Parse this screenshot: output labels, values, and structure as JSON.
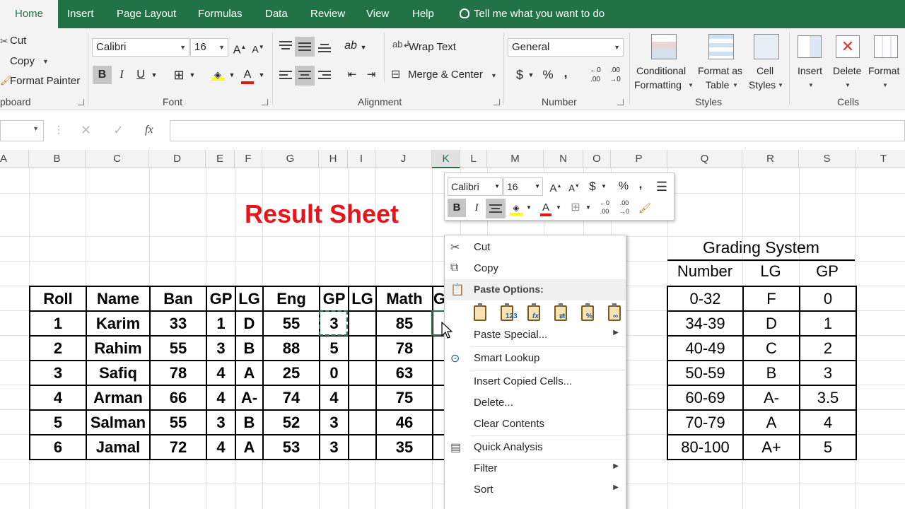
{
  "tabs": [
    "Home",
    "Insert",
    "Page Layout",
    "Formulas",
    "Data",
    "Review",
    "View",
    "Help"
  ],
  "tell_me": "Tell me what you want to do",
  "clipboard": {
    "cut": "Cut",
    "copy": "Copy",
    "format_painter": "Format Painter",
    "label": "pboard"
  },
  "font": {
    "name": "Calibri",
    "size": "16",
    "label": "Font"
  },
  "alignment": {
    "wrap": "Wrap Text",
    "merge": "Merge & Center",
    "label": "Alignment"
  },
  "number": {
    "format": "General",
    "label": "Number"
  },
  "styles": {
    "cond1": "Conditional",
    "cond2": "Formatting",
    "fat1": "Format as",
    "fat2": "Table",
    "cs1": "Cell",
    "cs2": "Styles",
    "label": "Styles"
  },
  "cells": {
    "insert": "Insert",
    "delete": "Delete",
    "format": "Format",
    "label": "Cells"
  },
  "formula_bar": {
    "fx": "fx",
    "value": ""
  },
  "columns": [
    "A",
    "B",
    "C",
    "D",
    "E",
    "F",
    "G",
    "H",
    "I",
    "J",
    "K",
    "L",
    "M",
    "N",
    "O",
    "P",
    "Q",
    "R",
    "S",
    "T"
  ],
  "sheet_title": "Result Sheet",
  "result_table": {
    "headers": [
      "Roll",
      "Name",
      "Ban",
      "GP",
      "LG",
      "Eng",
      "GP",
      "LG",
      "Math",
      "G"
    ],
    "rows": [
      [
        "1",
        "Karim",
        "33",
        "1",
        "D",
        "55",
        "3",
        "",
        "85"
      ],
      [
        "2",
        "Rahim",
        "55",
        "3",
        "B",
        "88",
        "5",
        "",
        "78"
      ],
      [
        "3",
        "Safiq",
        "78",
        "4",
        "A",
        "25",
        "0",
        "",
        "63"
      ],
      [
        "4",
        "Arman",
        "66",
        "4",
        "A-",
        "74",
        "4",
        "",
        "75"
      ],
      [
        "5",
        "Salman",
        "55",
        "3",
        "B",
        "52",
        "3",
        "",
        "46"
      ],
      [
        "6",
        "Jamal",
        "72",
        "4",
        "A",
        "53",
        "3",
        "",
        "35"
      ]
    ]
  },
  "grading": {
    "title": "Grading System",
    "headers": [
      "Number",
      "LG",
      "GP"
    ],
    "rows": [
      [
        "0-32",
        "F",
        "0"
      ],
      [
        "34-39",
        "D",
        "1"
      ],
      [
        "40-49",
        "C",
        "2"
      ],
      [
        "50-59",
        "B",
        "3"
      ],
      [
        "60-69",
        "A-",
        "3.5"
      ],
      [
        "70-79",
        "A",
        "4"
      ],
      [
        "80-100",
        "A+",
        "5"
      ]
    ]
  },
  "mini_toolbar": {
    "font": "Calibri",
    "size": "16"
  },
  "context_menu": {
    "cut": "Cut",
    "copy": "Copy",
    "paste_options": "Paste Options:",
    "paste_special": "Paste Special...",
    "smart_lookup": "Smart Lookup",
    "insert_copied": "Insert Copied Cells...",
    "delete": "Delete...",
    "clear": "Clear Contents",
    "quick_analysis": "Quick Analysis",
    "filter": "Filter",
    "sort": "Sort"
  },
  "colors": {
    "excel_green": "#217346",
    "title_red": "#e8141c"
  }
}
